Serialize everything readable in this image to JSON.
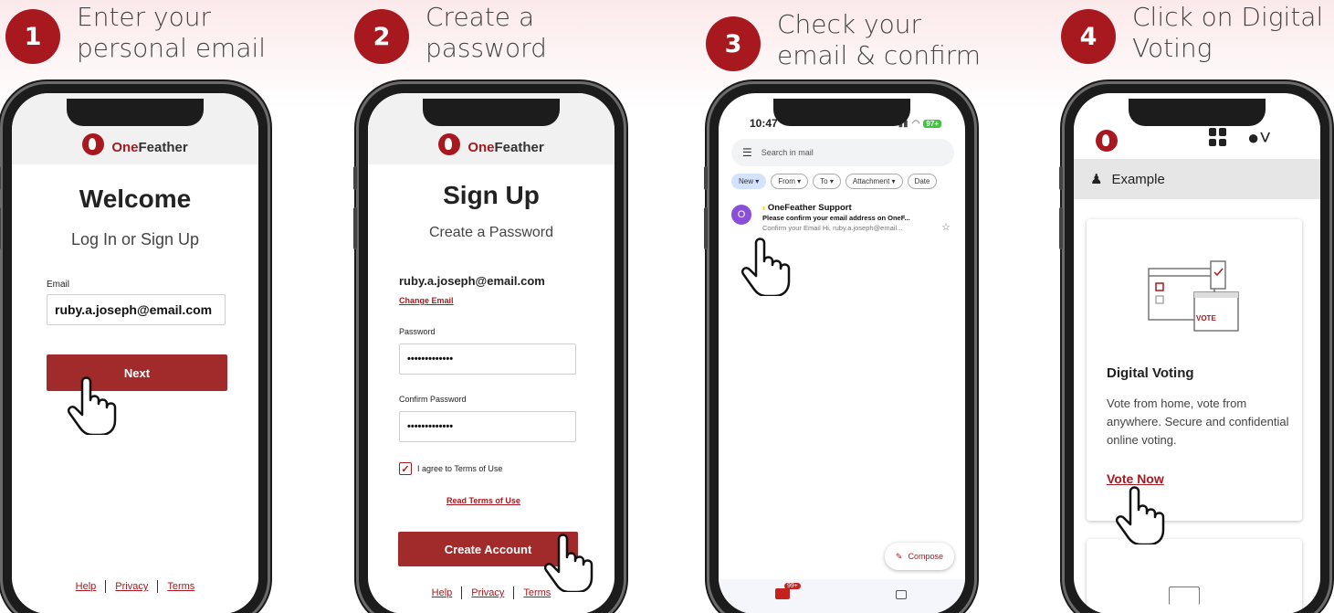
{
  "steps": [
    {
      "num": "1",
      "text": "Enter your\npersonal email"
    },
    {
      "num": "2",
      "text": "Create a\npassword"
    },
    {
      "num": "3",
      "text": "Check your\nemail & confirm"
    },
    {
      "num": "4",
      "text": "Click on Digital\nVoting"
    }
  ],
  "brand": {
    "one": "One",
    "feather": "Feather"
  },
  "screen1": {
    "heading": "Welcome",
    "subheading": "Log In or Sign Up",
    "email_label": "Email",
    "email_value": "ruby.a.joseph@email.com",
    "next_button": "Next"
  },
  "screen2": {
    "heading": "Sign Up",
    "subheading": "Create a Password",
    "email": "ruby.a.joseph@email.com",
    "change_email": "Change Email",
    "password_label": "Password",
    "password_value": "•••••••••••••",
    "confirm_label": "Confirm Password",
    "confirm_value": "•••••••••••••",
    "agree_label": "I agree to Terms of Use",
    "read_terms": "Read Terms of Use",
    "create_button": "Create Account"
  },
  "footer": {
    "help": "Help",
    "privacy": "Privacy",
    "terms": "Terms"
  },
  "screen3": {
    "time": "10:47",
    "battery": "97+",
    "search_placeholder": "Search in mail",
    "chips": [
      "New ▾",
      "From ▾",
      "To ▾",
      "Attachment ▾",
      "Date"
    ],
    "mail": {
      "avatar": "O",
      "from": "OneFeather Support",
      "subject": "Please confirm your email address on OneF...",
      "preview": "Confirm your Email Hi, ruby.a.joseph@email..."
    },
    "compose": "Compose",
    "badge": "99+"
  },
  "screen4": {
    "user": "Example",
    "card_title": "Digital Voting",
    "card_desc": "Vote from home, vote from anywhere. Secure and confidential online voting.",
    "card_link": "Vote Now",
    "ballot_label": "VOTE"
  },
  "colors": {
    "brand_red": "#a8191f",
    "button_red": "#a12a2a"
  }
}
